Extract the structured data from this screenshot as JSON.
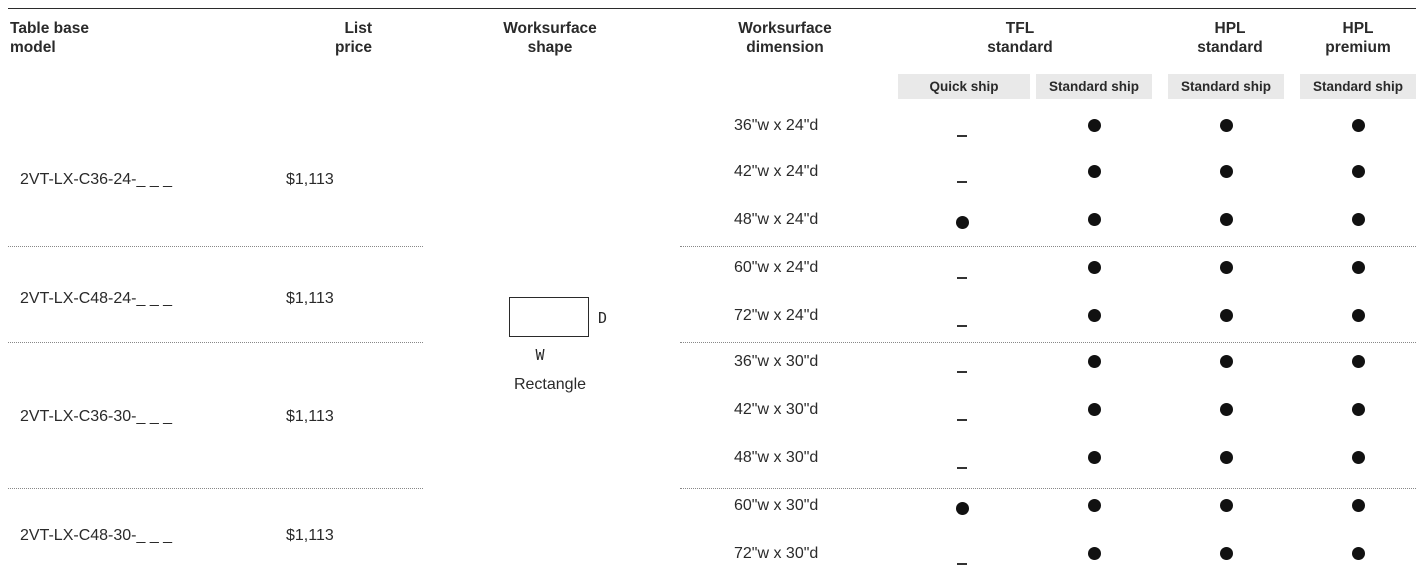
{
  "headers": {
    "model": [
      "Table base",
      "model"
    ],
    "price": [
      "List",
      "price"
    ],
    "shape": [
      "Worksurface",
      "shape"
    ],
    "dimension": [
      "Worksurface",
      "dimension"
    ],
    "tfl": [
      "TFL",
      "standard"
    ],
    "hpl_std": [
      "HPL",
      "standard"
    ],
    "hpl_prem": [
      "HPL",
      "premium"
    ]
  },
  "ship_labels": [
    "Quick ship",
    "Standard ship",
    "Standard ship",
    "Standard ship"
  ],
  "shape": {
    "name": "Rectangle",
    "w_label": "W",
    "d_label": "D"
  },
  "groups": [
    {
      "model": "2VT-LX-C36-24-_ _ _",
      "price": "$1,113"
    },
    {
      "model": "2VT-LX-C48-24-_ _ _",
      "price": "$1,113"
    },
    {
      "model": "2VT-LX-C36-30-_ _ _",
      "price": "$1,113"
    },
    {
      "model": "2VT-LX-C48-30-_ _ _",
      "price": "$1,113"
    }
  ],
  "rows": [
    {
      "dimension": "36\"w x 24\"d",
      "quick_ship": false,
      "tfl_standard": true,
      "hpl_standard": true,
      "hpl_premium": true
    },
    {
      "dimension": "42\"w x 24\"d",
      "quick_ship": false,
      "tfl_standard": true,
      "hpl_standard": true,
      "hpl_premium": true
    },
    {
      "dimension": "48\"w x 24\"d",
      "quick_ship": true,
      "tfl_standard": true,
      "hpl_standard": true,
      "hpl_premium": true
    },
    {
      "dimension": "60\"w x 24\"d",
      "quick_ship": false,
      "tfl_standard": true,
      "hpl_standard": true,
      "hpl_premium": true
    },
    {
      "dimension": "72\"w x 24\"d",
      "quick_ship": false,
      "tfl_standard": true,
      "hpl_standard": true,
      "hpl_premium": true
    },
    {
      "dimension": "36\"w x 30\"d",
      "quick_ship": false,
      "tfl_standard": true,
      "hpl_standard": true,
      "hpl_premium": true
    },
    {
      "dimension": "42\"w x 30\"d",
      "quick_ship": false,
      "tfl_standard": true,
      "hpl_standard": true,
      "hpl_premium": true
    },
    {
      "dimension": "48\"w x 30\"d",
      "quick_ship": false,
      "tfl_standard": true,
      "hpl_standard": true,
      "hpl_premium": true
    },
    {
      "dimension": "60\"w x 30\"d",
      "quick_ship": true,
      "tfl_standard": true,
      "hpl_standard": true,
      "hpl_premium": true
    },
    {
      "dimension": "72\"w x 30\"d",
      "quick_ship": false,
      "tfl_standard": true,
      "hpl_standard": true,
      "hpl_premium": true
    }
  ]
}
